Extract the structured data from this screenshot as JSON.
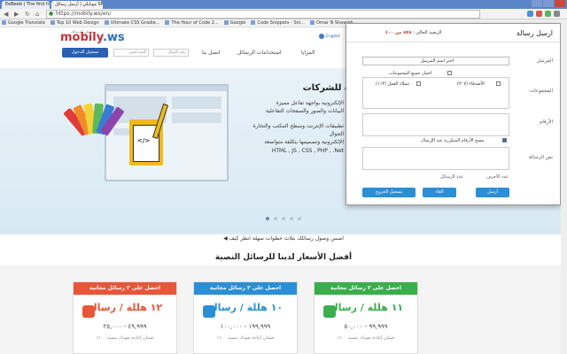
{
  "browser": {
    "tabs": [
      {
        "label": "EeBeeb | The first hybrid",
        "active": false
      },
      {
        "label": "موبايلي | أرسل رسائل SMS",
        "active": true
      }
    ],
    "url": "https://mobily.ws/en/",
    "bookmarks": [
      "Google Translate",
      "Top 10 Web Design",
      "Ultimate CSS Gradie...",
      "The Hour of Code 2...",
      "Google",
      "Code Snippets - Sni...",
      "Omar N Shawish"
    ]
  },
  "header": {
    "logo_main": "mobily",
    "logo_suffix": ".ws",
    "logo_tagline": "موبايلي للرسائل",
    "english_link": "English",
    "login_button": "تسجيل الدخول",
    "mobile_placeholder": "رقم الجوال",
    "password_placeholder": "كلمة السر",
    "nav": [
      "المزايا",
      "استخدامات الرسائل",
      "اتصل بنا"
    ]
  },
  "hero": {
    "title": "مميزة للشركات",
    "lines": [
      "الإلكترونية بواجهة تفاعل مميزة",
      "البيانات والصور والصفحات التفاعلية",
      "تطبيقات الإنترنت وسطح المكتب والتجارة",
      "الجوال",
      "الإلكترونية وتصميمها بتكلفة متواضعة"
    ],
    "tech": "HTML , JS , CSS , PHP , .Net",
    "slides": 5,
    "active_slide": 0
  },
  "how_line": "اضمن وصول رسائلك بثلاث خطوات سهلة انظر كيف ◀",
  "prices_title": "أفضل الأسعار لدينا للرسائل النصية",
  "cards": [
    {
      "head": "احصل على ٣ رسائل مجانية",
      "price": "١٢ هللة / رسالة",
      "range": "٤٩,٩٩٩ - ٢٥,٠٠٠",
      "note": "ضمان إعادة نقودك بنسبة ١٠٠٪",
      "color": "#e8553a"
    },
    {
      "head": "احصل على ٣ رسائل مجانية",
      "price": "١٠ هللة / رسالة",
      "range": "١٩٩,٩٩٩ - ١٠٠,٠٠٠",
      "note": "ضمان إعادة نقودك بنسبة ١٠٠٪",
      "color": "#2b8fd6"
    },
    {
      "head": "احصل على ٣ رسائل مجانية",
      "price": "١١ هللة / رسالة",
      "range": "٩٩,٩٩٩ - ٥٠,٠٠٠",
      "note": "ضمان إعادة نقودك بنسبة ١٠٠٪",
      "color": "#3aae4a"
    }
  ],
  "modal": {
    "title": "ارسل رسالة",
    "balance_label": "الرصيد الحالي :",
    "balance_value": "٥٧٥ من ٤٠٠",
    "sender_label": "المرسل",
    "sender_value": "اختر اسم المرسل",
    "groups_label": "المجموعات",
    "select_all_groups": "اختيار جميع المجموعات",
    "group_friends": "الأصدقاء (٣٠٧)",
    "group_clients": "عملاء العمل (١١٣)",
    "numbers_label": "الأرقام",
    "delete_repeated": "مسح الأرقام المتكررة عند الإرسال",
    "message_label": "نص الرسالة",
    "char_count_label": "عدد الأحرف",
    "msg_count_label": "عدد الرسائل",
    "send_button": "أرسل",
    "cancel_button": "الغاء",
    "logout_button": "تسجيل الخروج"
  }
}
